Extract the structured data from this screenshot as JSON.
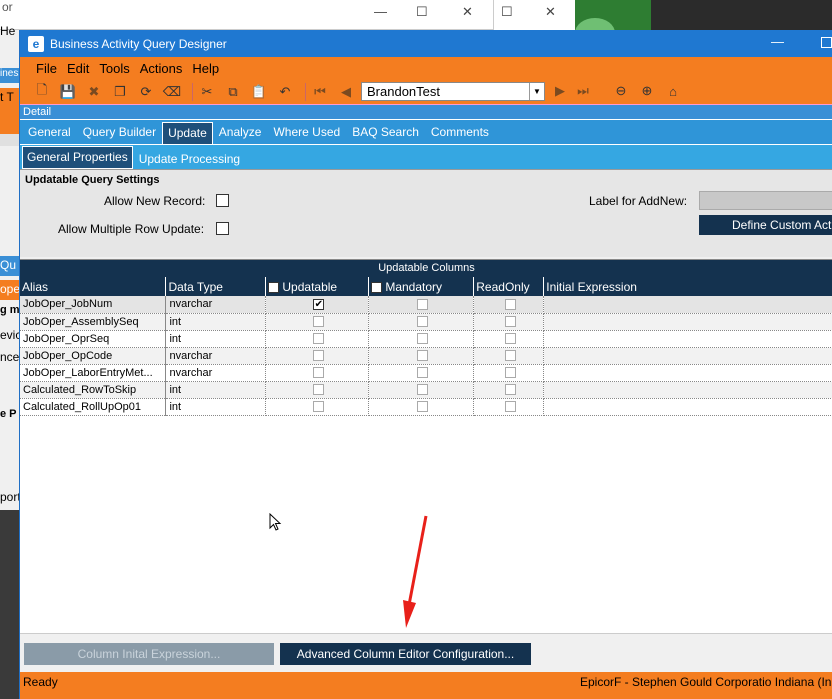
{
  "background": {
    "win1_title": "or",
    "left_strip": [
      "He",
      "iness A",
      "t  T",
      "Qu",
      "ope",
      "g me",
      "evic",
      "nce",
      "e P",
      "port"
    ]
  },
  "window": {
    "title": "Business Activity Query Designer",
    "min_glyph": "—",
    "accent_color": "#f47d20",
    "title_color": "#1f78d1"
  },
  "menu": [
    "File",
    "Edit",
    "Tools",
    "Actions",
    "Help"
  ],
  "toolbar": {
    "query_name": "BrandonTest"
  },
  "detail_label": "Detail",
  "tabs": [
    "General",
    "Query Builder",
    "Update",
    "Analyze",
    "Where Used",
    "BAQ Search",
    "Comments"
  ],
  "active_tab": "Update",
  "subtabs": [
    "General Properties",
    "Update Processing"
  ],
  "settings": {
    "header": "Updatable Query Settings",
    "allow_new_record_label": "Allow New Record:",
    "allow_multiple_row_label": "Allow Multiple Row Update:",
    "label_for_addnew": "Label for AddNew:",
    "define_custom_action_btn": "Define Custom Actio"
  },
  "grid": {
    "title": "Updatable Columns",
    "columns": [
      "Alias",
      "Data Type",
      "Updatable",
      "Mandatory",
      "ReadOnly",
      "Initial Expression"
    ],
    "rows": [
      {
        "alias": "JobOper_JobNum",
        "type": "nvarchar",
        "updatable": true,
        "mandatory": false,
        "readonly": false
      },
      {
        "alias": "JobOper_AssemblySeq",
        "type": "int",
        "updatable": false,
        "mandatory": false,
        "readonly": false
      },
      {
        "alias": "JobOper_OprSeq",
        "type": "int",
        "updatable": false,
        "mandatory": false,
        "readonly": false
      },
      {
        "alias": "JobOper_OpCode",
        "type": "nvarchar",
        "updatable": false,
        "mandatory": false,
        "readonly": false
      },
      {
        "alias": "JobOper_LaborEntryMet...",
        "type": "nvarchar",
        "updatable": false,
        "mandatory": false,
        "readonly": false
      },
      {
        "alias": "Calculated_RowToSkip",
        "type": "int",
        "updatable": false,
        "mandatory": false,
        "readonly": false
      },
      {
        "alias": "Calculated_RollUpOp01",
        "type": "int",
        "updatable": false,
        "mandatory": false,
        "readonly": false
      }
    ]
  },
  "buttons": {
    "column_initial_expression": "Column Inital Expression...",
    "advanced_column_editor": "Advanced Column Editor Configuration..."
  },
  "status": {
    "left": "Ready",
    "right": "EpicorF - Stephen Gould Corporatio  Indiana (Ind"
  }
}
